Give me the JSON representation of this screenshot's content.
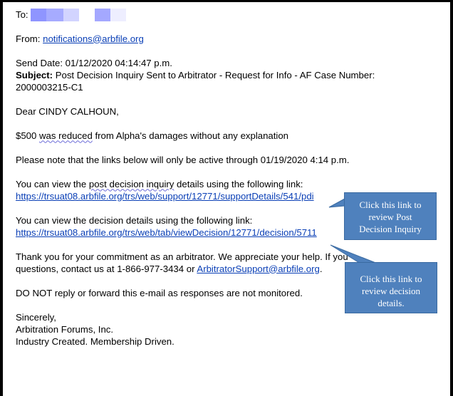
{
  "email": {
    "to_label": "To:",
    "from_label": "From:",
    "from_address": "notifications@arbfile.org",
    "send_date": "Send Date: 01/12/2020 04:14:47 p.m.",
    "subject_label": "Subject:",
    "subject_text": " Post Decision Inquiry Sent to Arbitrator - Request for Info - AF Case Number:",
    "subject_text_2": "2000003215-C1",
    "greeting": "Dear CINDY CALHOUN,",
    "damages_before": "$500 ",
    "damages_sq1": "was reduced",
    "damages_after": " from Alpha's damages without any explanation",
    "active_note": "Please note that the links below will only be active through 01/19/2020 4:14 p.m.",
    "pdi_intro_before": "You can view the ",
    "pdi_intro_sq": "post decision inquiry",
    "pdi_intro_after": " details using the following link:",
    "pdi_link": "https://trsuat08.arbfile.org/trs/web/support/12771/supportDetails/541/pdi",
    "decision_intro": "You can view the decision details using the following link:",
    "decision_link": "https://trsuat08.arbfile.org/trs/web/tab/viewDecision/12771/decision/5711",
    "thanks_before": "Thank you for your commitment as an arbitrator. We appreciate your help. If you",
    "thanks_line2_before": "questions, contact us at 1-866-977-3434 or ",
    "support_email": "ArbitratorSupport@arbfile.org",
    "thanks_line2_after": ".",
    "do_not_reply": "DO NOT reply or forward this e-mail as responses are not monitored.",
    "closing": "Sincerely,",
    "org": "Arbitration Forums, Inc.",
    "tagline": "Industry Created. Membership Driven."
  },
  "callouts": {
    "pdi": [
      "Click this link to",
      "review Post",
      "Decision Inquiry"
    ],
    "decision": [
      "Click this link to",
      "review decision",
      "details."
    ]
  },
  "colors": {
    "link": "#0a3fb6",
    "callout_fill": "#4f81bd",
    "redaction": "#a4a8ff"
  }
}
